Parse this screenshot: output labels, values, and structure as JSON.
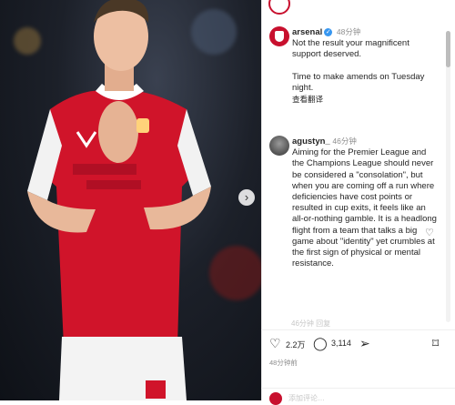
{
  "post": {
    "likes": "2.2万",
    "comments_count": "3,114",
    "time_ago": "48分钟前"
  },
  "comments": [
    {
      "username": "arsenal",
      "verified": true,
      "time": "48分钟",
      "lines": [
        "Not the result your magnificent support deserved.",
        "Time to make amends on Tuesday night."
      ],
      "translate_label": "查看翻译"
    },
    {
      "username": "agustyn_",
      "time": "46分钟",
      "text": "Aiming for the Premier League and the Champions League should never be considered a \"consolation\", but when you are coming off a run where deficiencies have cost points or resulted in cup exits, it feels like an all-or-nothing gamble. It is a headlong flight from a team that talks a big game about \"identity\" yet crumbles at the first sign of physical or mental resistance."
    }
  ],
  "faded_text": "46分钟  回复",
  "add_comment_placeholder": "添加评论…",
  "colors": {
    "brand_red": "#c8102e",
    "verified_blue": "#3897f0"
  },
  "icons": [
    "heart-icon",
    "comment-icon",
    "share-icon",
    "bookmark-icon",
    "chevron-right-icon"
  ]
}
